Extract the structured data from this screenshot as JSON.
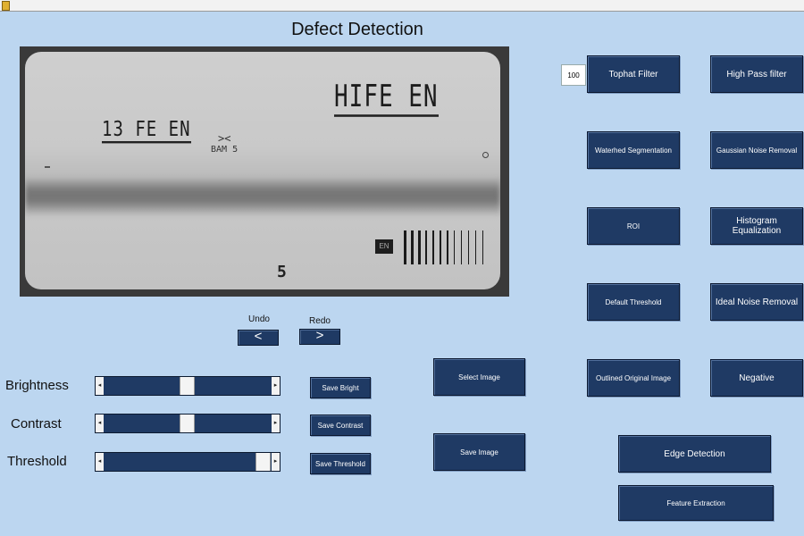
{
  "window": {
    "title": "Defect Detection"
  },
  "viewer": {
    "film_labels": {
      "left": "13 FE EN",
      "right": "HIFE EN",
      "mark": "><",
      "bam": "BAM 5",
      "number": "5",
      "iqi_tag": "EN"
    }
  },
  "history": {
    "undo_label": "Undo",
    "redo_label": "Redo",
    "undo_glyph": "<",
    "redo_glyph": ">"
  },
  "adjustments": {
    "brightness": {
      "label": "Brightness",
      "value": 0.49,
      "save_label": "Save Bright"
    },
    "contrast": {
      "label": "Contrast",
      "value": 0.49,
      "save_label": "Save Contrast"
    },
    "threshold": {
      "label": "Threshold",
      "value": 0.98,
      "save_label": "Save Threshold"
    }
  },
  "file_actions": {
    "select_image": "Select Image",
    "save_image": "Save Image"
  },
  "tophat": {
    "value": "100"
  },
  "filters": {
    "tophat": "Tophat Filter",
    "high_pass": "High Pass filter",
    "watershed": "Waterhed Segmentation",
    "gaussian": "Gaussian Noise Removal",
    "roi": "ROI",
    "histogram": "Histogram Equalization",
    "default_threshold": "Default Threshold",
    "ideal_noise": "Ideal Noise Removal",
    "outlined": "Outlined Original Image",
    "negative": "Negative",
    "edge_detection": "Edge Detection",
    "feature_extraction": "Feature Extraction"
  },
  "colors": {
    "background": "#bcd6f0",
    "button": "#1f3a64",
    "button_text": "#ffffff"
  }
}
